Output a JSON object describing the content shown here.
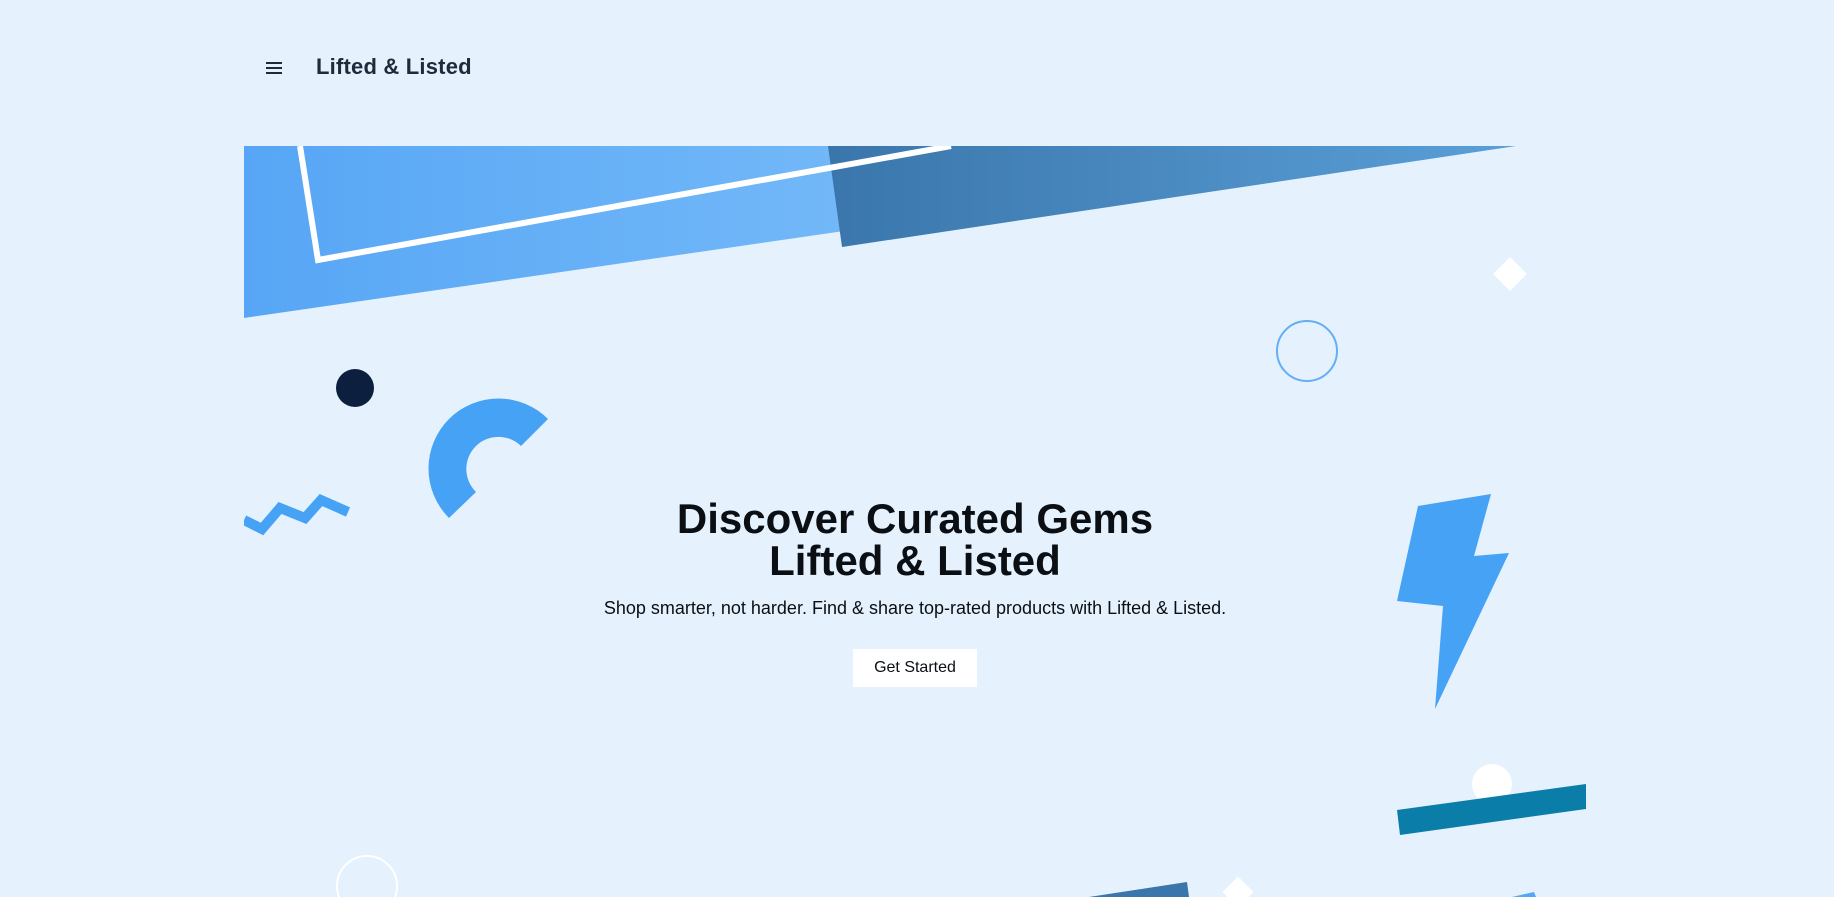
{
  "header": {
    "menu_icon": "hamburger-menu-icon",
    "brand": "Lifted & Listed"
  },
  "hero": {
    "title_line1": "Discover Curated Gems",
    "title_line2": "Lifted & Listed",
    "subtitle": "Shop smarter, not harder. Find & share top-rated products with Lifted & Listed.",
    "cta_label": "Get Started"
  },
  "colors": {
    "background": "#e5f1fd",
    "light_blue": "#5aa9f5",
    "steel_blue": "#3a78ad",
    "bright_blue": "#45a2f5",
    "navy": "#0c1f3f",
    "teal": "#0a7ea8",
    "white": "#ffffff"
  }
}
